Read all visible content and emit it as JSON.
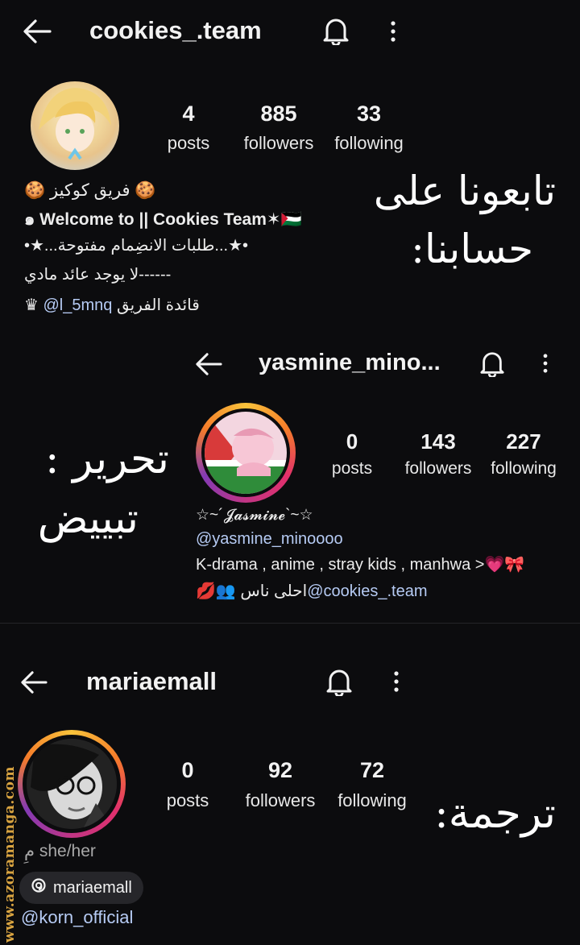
{
  "profile1": {
    "username": "cookies_.team",
    "stats": [
      {
        "value": "4",
        "label": "posts"
      },
      {
        "value": "885",
        "label": "followers"
      },
      {
        "value": "33",
        "label": "following"
      }
    ],
    "bio": [
      "🍪 فريق كوكيز 🍪",
      "๑ Welcome to || Cookies Team✶🇵🇸",
      "•★...طلبات الانضِمام مفتوحة...★•",
      "لا يوجد عائد مادي------",
      "♛ @l_5mnq قائدة الفريق"
    ],
    "bio_mention": "@l_5mnq",
    "bio_mention_prefix": "♛ ",
    "bio_mention_suffix": " قائدة الفريق"
  },
  "profile2": {
    "username": "yasmine_mino...",
    "stats": [
      {
        "value": "0",
        "label": "posts"
      },
      {
        "value": "143",
        "label": "followers"
      },
      {
        "value": "227",
        "label": "following"
      }
    ],
    "display_name": "☆~´𝓙𝓪𝓼𝓶𝓲𝓷𝓮`~☆",
    "handle": "@yasmine_minoooo",
    "bio_line": "K-drama , anime , stray kids , manhwa >💗🎀",
    "mention": "@cookies_.team",
    "mention_suffix": "💋👥 احلى ناس"
  },
  "profile3": {
    "username": "mariaemall",
    "stats": [
      {
        "value": "0",
        "label": "posts"
      },
      {
        "value": "92",
        "label": "followers"
      },
      {
        "value": "72",
        "label": "following"
      }
    ],
    "pronouns": "she/her",
    "pronoun_icon": "مِ",
    "threads_label": "mariaemall",
    "link": "@korn_official"
  },
  "annotations": {
    "follow_line1": "تابعونا على",
    "follow_line2": "حسابنا:",
    "edit_line1": "تحرير :",
    "edit_line2": "تبييض",
    "translate": "ترجمة:"
  },
  "watermark": "www.azoramanga.com",
  "colors": {
    "background": "#0c0c0e",
    "link": "#b6cbf4",
    "watermark": "#d9a441"
  }
}
